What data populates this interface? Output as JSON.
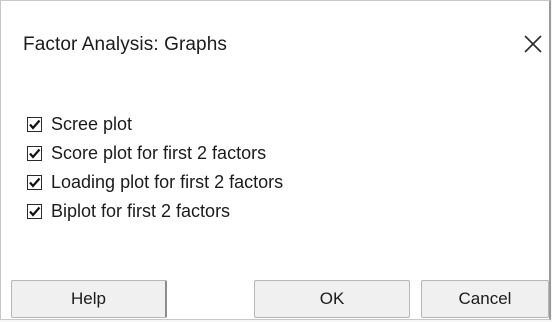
{
  "window": {
    "title": "Factor Analysis: Graphs"
  },
  "options": [
    {
      "label": "Scree plot",
      "checked": true
    },
    {
      "label": "Score plot for first 2 factors",
      "checked": true
    },
    {
      "label": "Loading plot for first 2 factors",
      "checked": true
    },
    {
      "label": "Biplot for first 2 factors",
      "checked": true
    }
  ],
  "buttons": {
    "help": "Help",
    "ok": "OK",
    "cancel": "Cancel"
  },
  "icons": {
    "close": "close-icon",
    "check": "checkmark-icon"
  }
}
